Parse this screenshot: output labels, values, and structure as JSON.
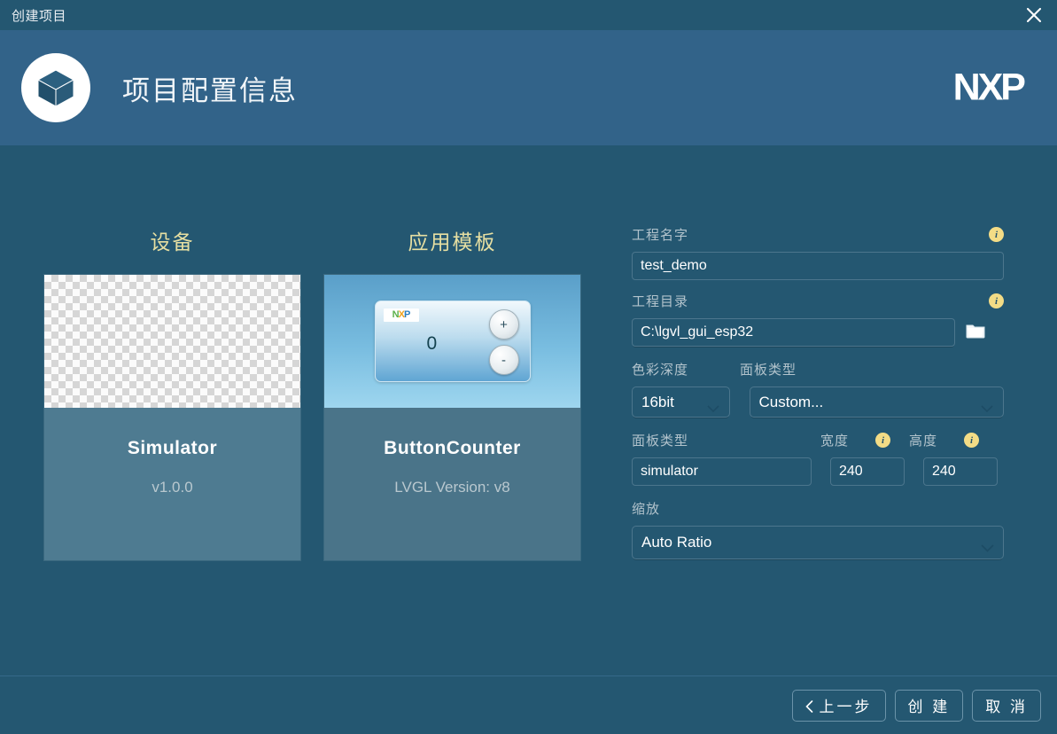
{
  "window": {
    "title": "创建项目",
    "close_icon": "close-icon"
  },
  "header": {
    "title": "项目配置信息",
    "logo_icon": "cube-icon",
    "brand": "NXP"
  },
  "cards": [
    {
      "title": "设备",
      "name": "Simulator",
      "subtitle": "v1.0.0",
      "thumb": "transparent-checkerboard",
      "selected": false
    },
    {
      "title": "应用模板",
      "name": "ButtonCounter",
      "subtitle": "LVGL Version: v8",
      "thumb": "button-counter-preview",
      "selected": true,
      "preview": {
        "brand": "NXP",
        "count": "0",
        "plus_label": "+",
        "minus_label": "-"
      }
    }
  ],
  "form": {
    "project_name": {
      "label": "工程名字",
      "value": "test_demo",
      "placeholder": "",
      "info_icon": "info-icon"
    },
    "project_dir": {
      "label": "工程目录",
      "value": "C:\\lgvl_gui_esp32",
      "placeholder": "",
      "info_icon": "info-icon",
      "browse_icon": "folder-icon"
    },
    "color_depth": {
      "label": "色彩深度",
      "value": "16bit",
      "options": [
        "16bit"
      ]
    },
    "panel_type_select": {
      "label": "面板类型",
      "value": "Custom...",
      "options": [
        "Custom..."
      ]
    },
    "panel_type_text": {
      "label": "面板类型",
      "value": "simulator",
      "placeholder": ""
    },
    "width": {
      "label": "宽度",
      "value": "240",
      "info_icon": "info-icon"
    },
    "height": {
      "label": "高度",
      "value": "240",
      "info_icon": "info-icon"
    },
    "scale": {
      "label": "缩放",
      "value": "Auto Ratio",
      "options": [
        "Auto Ratio"
      ]
    }
  },
  "footer": {
    "prev_label": "上一步",
    "create_label": "创 建",
    "cancel_label": "取 消",
    "prev_icon": "chevron-left-icon"
  },
  "colors": {
    "window_bg": "#245771",
    "header_bg": "#326389",
    "card_bg": "#4e7b91",
    "accent_yellow": "#e6dfa2",
    "info_badge": "#f3dc86",
    "text_primary": "#ffffff",
    "text_muted": "#b2c3cc",
    "border": "#4c768d"
  }
}
